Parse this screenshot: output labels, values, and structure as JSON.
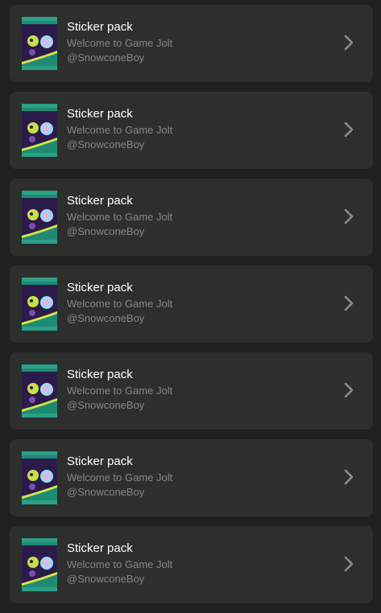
{
  "items": [
    {
      "title": "Sticker pack",
      "subtitle": "Welcome to Game Jolt",
      "author": "@SnowconeBoy",
      "icon": "sticker-pack-icon"
    },
    {
      "title": "Sticker pack",
      "subtitle": "Welcome to Game Jolt",
      "author": "@SnowconeBoy",
      "icon": "sticker-pack-icon"
    },
    {
      "title": "Sticker pack",
      "subtitle": "Welcome to Game Jolt",
      "author": "@SnowconeBoy",
      "icon": "sticker-pack-icon"
    },
    {
      "title": "Sticker pack",
      "subtitle": "Welcome to Game Jolt",
      "author": "@SnowconeBoy",
      "icon": "sticker-pack-icon"
    },
    {
      "title": "Sticker pack",
      "subtitle": "Welcome to Game Jolt",
      "author": "@SnowconeBoy",
      "icon": "sticker-pack-icon"
    },
    {
      "title": "Sticker pack",
      "subtitle": "Welcome to Game Jolt",
      "author": "@SnowconeBoy",
      "icon": "sticker-pack-icon"
    },
    {
      "title": "Sticker pack",
      "subtitle": "Welcome to Game Jolt",
      "author": "@SnowconeBoy",
      "icon": "sticker-pack-icon"
    }
  ],
  "colors": {
    "background": "#1f201f",
    "card": "#2d2f2c",
    "title": "#ffffff",
    "muted": "#85887f",
    "chevron": "#8a8c86",
    "pack_teal": "#1f8a72",
    "pack_purple": "#2b1b4a",
    "pack_yellow": "#d9e34a"
  }
}
